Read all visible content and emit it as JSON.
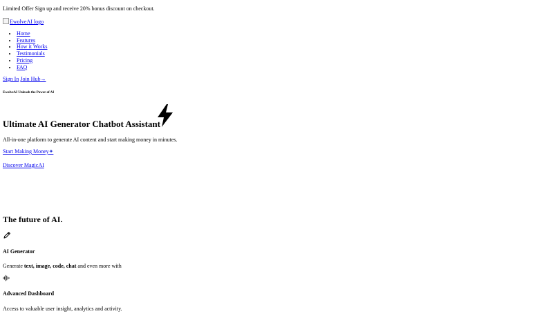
{
  "promo": {
    "text": "Limited Offer Sign up and receive 20% bonus discount on checkout."
  },
  "header": {
    "logo_alt": "EwolveAI logo",
    "nav": [
      "Home",
      "Features",
      "How it Works",
      "Testimonials",
      "Pricing",
      "FAQ"
    ],
    "signin_label": "Sign In",
    "join_label": "Join Hub",
    "join_arrow": "→"
  },
  "hero": {
    "tagline": "EwolveAI Unleash the Power of AI",
    "title": "Ultimate AI Generator Chatbot Assistant",
    "bolt_icon": "lightning-bolt-icon",
    "subtitle": "All-in-one platform to generate AI content and start making money in minutes.",
    "cta_label": "Start Making Money",
    "cta_sparkle": "✦",
    "discover_label": "Discover MagicAI"
  },
  "features": {
    "heading": "The future of AI.",
    "items": [
      {
        "icon": "pencil-icon",
        "title": "AI Generator",
        "desc_prefix": "Generate ",
        "desc_bold": "text, image, code, chat",
        "desc_suffix": " and even more with"
      },
      {
        "icon": "audio-wave-icon",
        "title": "Advanced Dashboard",
        "desc": "Access to valuable user insight, analytics and activity."
      }
    ]
  },
  "colors": {
    "link": "#0000ee",
    "sparkle": "#2a3bd8",
    "text": "#000000"
  }
}
